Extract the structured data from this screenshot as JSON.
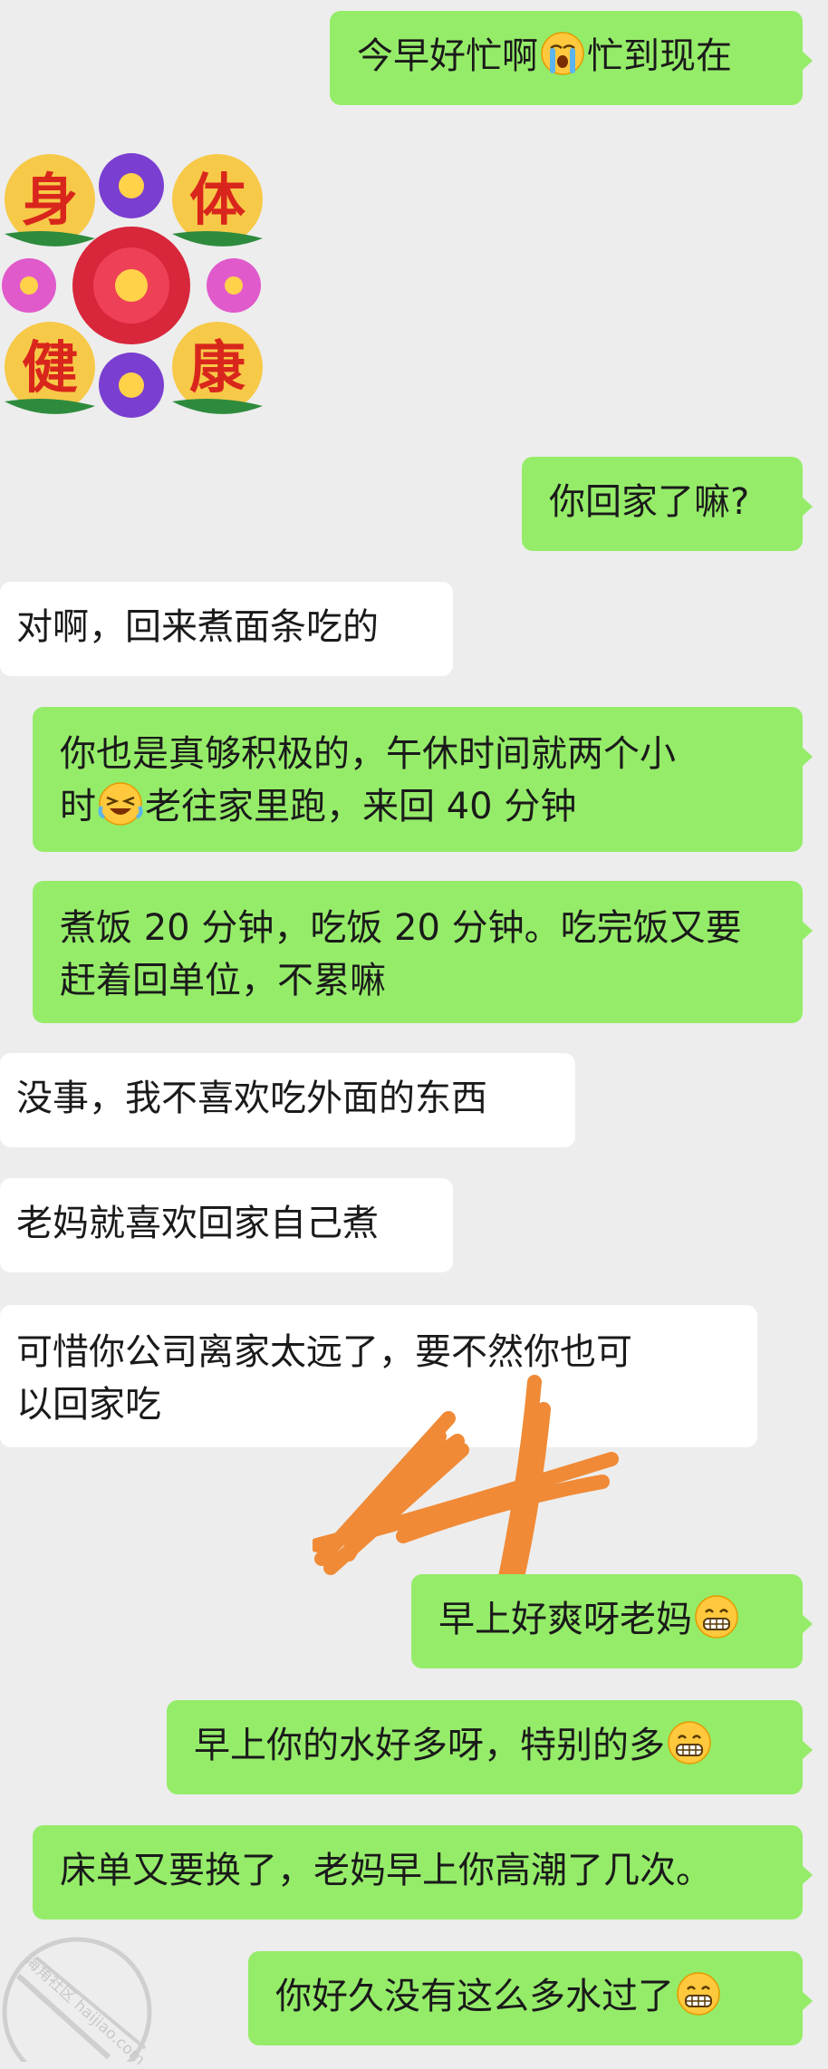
{
  "messages": [
    {
      "side": "out",
      "text": "今早好忙啊😭忙到现在"
    },
    {
      "side": "in",
      "type": "sticker",
      "text": "身体健康"
    },
    {
      "side": "out",
      "text": "你回家了嘛?"
    },
    {
      "side": "in",
      "text": "对啊，回来煮面条吃的"
    },
    {
      "side": "out",
      "line1": "你也是真够积极的，午休时间就两个小",
      "line2": "时😂老往家里跑，来回 40 分钟"
    },
    {
      "side": "out",
      "line1": "煮饭 20 分钟，吃饭 20 分钟。吃完饭又要",
      "line2": "赶着回单位，不累嘛"
    },
    {
      "side": "in",
      "text": "没事，我不喜欢吃外面的东西"
    },
    {
      "side": "in",
      "text": "老妈就喜欢回家自己煮"
    },
    {
      "side": "in",
      "line1": "可惜你公司离家太远了，要不然你也可",
      "line2": "以回家吃"
    },
    {
      "side": "out",
      "text": "早上好爽呀老妈😁"
    },
    {
      "side": "out",
      "text": "早上你的水好多呀，特别的多😁"
    },
    {
      "side": "out",
      "text": "床单又要换了，老妈早上你高潮了几次。"
    },
    {
      "side": "out",
      "text": "你好久没有这么多水过了😁"
    }
  ],
  "sticker": {
    "chars": [
      "身",
      "体",
      "健",
      "康"
    ]
  },
  "watermark": {
    "site": "海角社区",
    "domain": "haijiao.com"
  },
  "colors": {
    "background": "#ededed",
    "outgoing": "#95ec69",
    "incoming": "#ffffff",
    "scribble": "#f08a36"
  }
}
